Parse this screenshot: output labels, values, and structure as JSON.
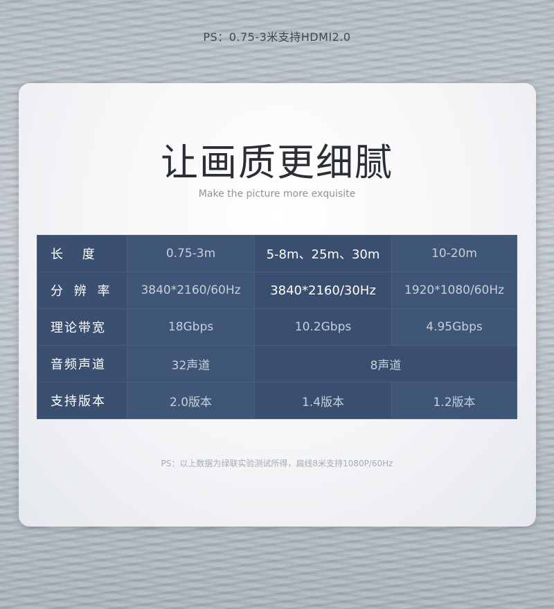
{
  "top_note": "PS：0.75-3米支持HDMI2.0",
  "headline": "让画质更细腻",
  "subline": "Make the picture more exquisite",
  "table": {
    "rows": [
      {
        "label": "长  度",
        "cells": [
          "0.75-3m",
          "5-8m、25m、30m",
          "10-20m"
        ]
      },
      {
        "label": "分 辨 率",
        "cells": [
          "3840*2160/60Hz",
          "3840*2160/30Hz",
          "1920*1080/60Hz"
        ]
      },
      {
        "label": "理论带宽",
        "cells": [
          "18Gbps",
          "10.2Gbps",
          "4.95Gbps"
        ]
      },
      {
        "label": "音频声道",
        "cells": [
          "32声道",
          "8声道"
        ]
      },
      {
        "label": "支持版本",
        "cells": [
          "2.0版本",
          "1.4版本",
          "1.2版本"
        ]
      }
    ]
  },
  "footnote": "PS：以上数据为绿联实验测试所得，扁线8米支持1080P/60Hz"
}
